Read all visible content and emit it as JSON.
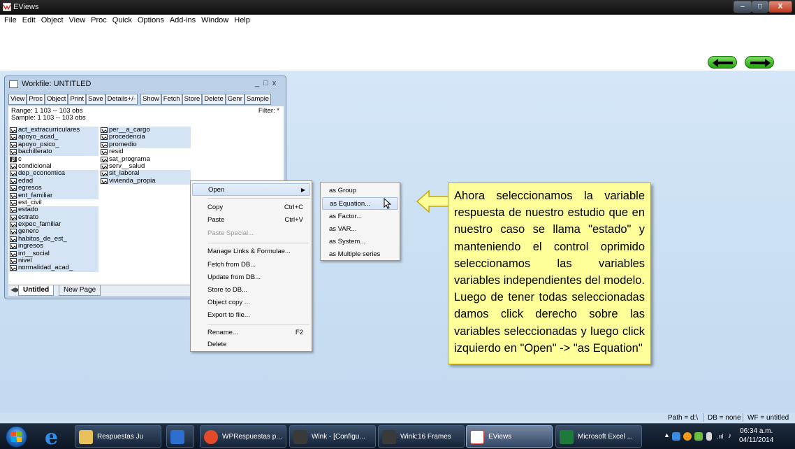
{
  "window": {
    "title": "EViews"
  },
  "menubar": [
    "File",
    "Edit",
    "Object",
    "View",
    "Proc",
    "Quick",
    "Options",
    "Add-ins",
    "Window",
    "Help"
  ],
  "workfile": {
    "title": "Workfile: UNTITLED",
    "toolbar": [
      "View",
      "Proc",
      "Object",
      "Print",
      "Save",
      "Details+/-",
      "Show",
      "Fetch",
      "Store",
      "Delete",
      "Genr",
      "Sample"
    ],
    "range": "Range:  1 103  --  103 obs",
    "sample": "Sample: 1 103  --  103 obs",
    "filter": "Filter: *",
    "col1": [
      {
        "name": "act_extracurriculares",
        "selected": true
      },
      {
        "name": "apoyo_acad_",
        "selected": true
      },
      {
        "name": "apoyo_psico_",
        "selected": true
      },
      {
        "name": "bachillerato",
        "selected": true
      },
      {
        "name": "c",
        "selected": false,
        "coef": true
      },
      {
        "name": "condicional",
        "selected": false
      },
      {
        "name": "dep_economica",
        "selected": true
      },
      {
        "name": "edad",
        "selected": true
      },
      {
        "name": "egresos",
        "selected": true
      },
      {
        "name": "ent_familiar",
        "selected": true
      },
      {
        "name": "est_civil",
        "selected": false
      },
      {
        "name": "estado",
        "selected": true
      },
      {
        "name": "estrato",
        "selected": true
      },
      {
        "name": "expec_familiar",
        "selected": true
      },
      {
        "name": "genero",
        "selected": true
      },
      {
        "name": "habitos_de_est_",
        "selected": true
      },
      {
        "name": "ingresos",
        "selected": true
      },
      {
        "name": "int__social",
        "selected": true
      },
      {
        "name": "nivel",
        "selected": true
      },
      {
        "name": "normalidad_acad_",
        "selected": true
      }
    ],
    "col2": [
      {
        "name": "per__a_cargo",
        "selected": true
      },
      {
        "name": "procedencia",
        "selected": true
      },
      {
        "name": "promedio",
        "selected": true
      },
      {
        "name": "resid",
        "selected": false
      },
      {
        "name": "sat_programa",
        "selected": false
      },
      {
        "name": "serv__salud",
        "selected": false
      },
      {
        "name": "sit_laboral",
        "selected": true
      },
      {
        "name": "vivienda_propia",
        "selected": true
      }
    ],
    "tabs": [
      "Untitled",
      "New Page"
    ]
  },
  "context_menu": [
    {
      "label": "Open",
      "shortcut": "",
      "submenu": true,
      "highlighted": true
    },
    {
      "label": "Copy",
      "shortcut": "Ctrl+C"
    },
    {
      "label": "Paste",
      "shortcut": "Ctrl+V"
    },
    {
      "label": "Paste Special...",
      "shortcut": "",
      "disabled": true
    },
    {
      "label": "Manage Links & Formulae...",
      "shortcut": ""
    },
    {
      "label": "Fetch from DB...",
      "shortcut": ""
    },
    {
      "label": "Update from DB...",
      "shortcut": ""
    },
    {
      "label": "Store to DB...",
      "shortcut": ""
    },
    {
      "label": "Object copy ...",
      "shortcut": ""
    },
    {
      "label": "Export to file...",
      "shortcut": ""
    },
    {
      "label": "Rename...",
      "shortcut": "F2"
    },
    {
      "label": "Delete",
      "shortcut": ""
    }
  ],
  "submenu": [
    "as Group",
    "as Equation...",
    "as Factor...",
    "as VAR...",
    "as System...",
    "as Multiple series"
  ],
  "callout": "Ahora seleccionamos la variable respuesta de nuestro estudio que en nuestro caso se llama \"estado\" y manteniendo el control oprimido seleccionamos las variables variables independientes del modelo. Luego de tener todas seleccionadas damos click derecho sobre las variables seleccionadas y luego click izquierdo en \"Open\" -> \"as Equation\"",
  "statusbar": {
    "path": "Path = d:\\",
    "db": "DB = none",
    "wf": "WF = untitled"
  },
  "taskbar": {
    "buttons": [
      {
        "label": "Respuestas Ju",
        "color": "#e8c15a"
      },
      {
        "label": "",
        "color": "#2d6fd1"
      },
      {
        "label": "WPRespuestas p...",
        "color": "#e24a2a"
      },
      {
        "label": "Wink - [Configu...",
        "color": "#2a2a2a"
      },
      {
        "label": "Wink:16 Frames",
        "color": "#2a2a2a"
      },
      {
        "label": "EViews",
        "color": "#d9433a"
      },
      {
        "label": "Microsoft Excel ...",
        "color": "#1e7a3a"
      }
    ],
    "time": "06:34 a.m.",
    "date": "04/11/2014"
  }
}
